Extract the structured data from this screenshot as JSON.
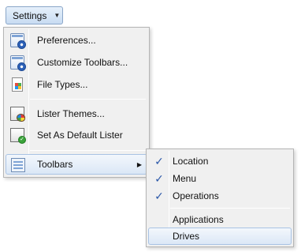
{
  "settings_button": {
    "label": "Settings",
    "arrow": "▼"
  },
  "menu": {
    "items": [
      {
        "label": "Preferences...",
        "icon": "preferences-icon"
      },
      {
        "label": "Customize Toolbars...",
        "icon": "customize-toolbars-icon"
      },
      {
        "label": "File Types...",
        "icon": "file-types-icon"
      },
      {
        "label": "Lister Themes...",
        "icon": "lister-themes-icon"
      },
      {
        "label": "Set As Default Lister",
        "icon": "default-lister-icon"
      },
      {
        "label": "Toolbars",
        "icon": "toolbars-icon",
        "submenu_arrow": "▶"
      }
    ]
  },
  "submenu": {
    "items": [
      {
        "label": "Location",
        "checked": true,
        "check": "✓"
      },
      {
        "label": "Menu",
        "checked": true,
        "check": "✓"
      },
      {
        "label": "Operations",
        "checked": true,
        "check": "✓"
      },
      {
        "label": "Applications",
        "checked": false
      },
      {
        "label": "Drives",
        "checked": false
      }
    ]
  },
  "colors": {
    "highlight_border": "#a9c3e4",
    "check": "#2a57a8",
    "menu_bg": "#f0f0f0"
  }
}
